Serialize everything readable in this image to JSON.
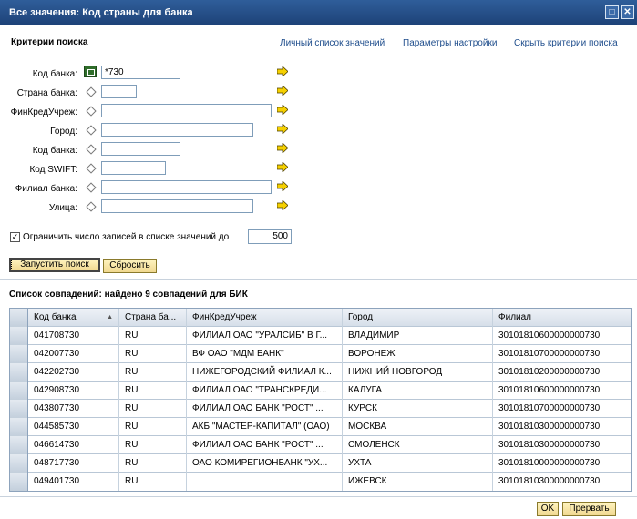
{
  "window": {
    "title": "Все значения: Код страны для банка",
    "maximize_glyph": "□",
    "close_glyph": "✕"
  },
  "criteria": {
    "title": "Критерии поиска",
    "links": [
      "Личный список значений",
      "Параметры настройки",
      "Скрыть критерии поиска"
    ],
    "fields": [
      {
        "label": "Код банка:",
        "value": "*730"
      },
      {
        "label": "Страна банка:",
        "value": ""
      },
      {
        "label": "ФинКредУчреж:",
        "value": ""
      },
      {
        "label": "Город:",
        "value": ""
      },
      {
        "label": "Код банка:",
        "value": ""
      },
      {
        "label": "Код SWIFT:",
        "value": ""
      },
      {
        "label": "Филиал банка:",
        "value": ""
      },
      {
        "label": "Улица:",
        "value": ""
      }
    ],
    "limit_checked": "✓",
    "limit_label": "Ограничить число записей в списке значений до",
    "limit_value": "500",
    "search_button": "Запустить поиск",
    "reset_button": "Сбросить"
  },
  "results": {
    "title": "Список совпадений: найдено 9 совпадений для БИК",
    "sort_indicator": "▲",
    "columns": [
      "Код банка",
      "Страна ба...",
      "ФинКредУчреж",
      "Город",
      "Филиал"
    ],
    "rows": [
      [
        "041708730",
        "RU",
        "ФИЛИАЛ ОАО \"УРАЛСИБ\" В Г...",
        "ВЛАДИМИР",
        "30101810600000000730"
      ],
      [
        "042007730",
        "RU",
        "ВФ ОАО \"МДМ БАНК\"",
        "ВОРОНЕЖ",
        "30101810700000000730"
      ],
      [
        "042202730",
        "RU",
        "НИЖЕГОРОДСКИЙ ФИЛИАЛ К...",
        "НИЖНИЙ НОВГОРОД",
        "30101810200000000730"
      ],
      [
        "042908730",
        "RU",
        "ФИЛИАЛ ОАО \"ТРАНСКРЕДИ...",
        "КАЛУГА",
        "30101810600000000730"
      ],
      [
        "043807730",
        "RU",
        "ФИЛИАЛ ОАО БАНК \"РОСТ\" ...",
        "КУРСК",
        "30101810700000000730"
      ],
      [
        "044585730",
        "RU",
        "АКБ \"МАСТЕР-КАПИТАЛ\" (ОАО)",
        "МОСКВА",
        "30101810300000000730"
      ],
      [
        "046614730",
        "RU",
        "ФИЛИАЛ ОАО БАНК \"РОСТ\" ...",
        "СМОЛЕНСК",
        "30101810300000000730"
      ],
      [
        "048717730",
        "RU",
        "ОАО КОМИРЕГИОНБАНК \"УХ...",
        "УХТА",
        "30101810000000000730"
      ],
      [
        "049401730",
        "RU",
        "",
        "ИЖЕВСК",
        "30101810300000000730"
      ]
    ]
  },
  "footer": {
    "ok_button": "OK",
    "cancel_button": "Прервать"
  }
}
